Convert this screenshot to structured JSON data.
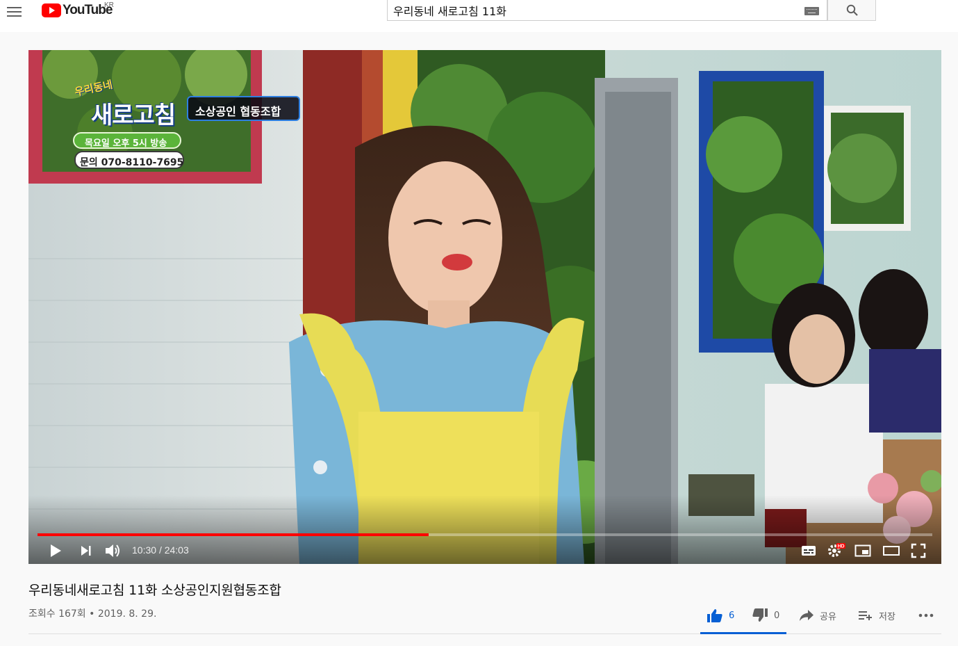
{
  "header": {
    "logo_text": "YouTube",
    "country_code": "KR",
    "search_value": "우리동네 새로고침 11화"
  },
  "player": {
    "overlay": {
      "show_title_small": "우리동네",
      "show_title_big": "새로고침",
      "episode_banner": "소상공인 협동조합",
      "air_time": "목요일 오후 5시 방송",
      "contact": "문의 070-8110-7695"
    },
    "time_current": "10:30",
    "time_total": "24:03",
    "progress_fraction": 0.437
  },
  "video": {
    "title": "우리동네새로고침 11화 소상공인지원협동조합",
    "meta": "조회수 167회 • 2019. 8. 29.",
    "likes": "6",
    "dislikes": "0",
    "share_label": "공유",
    "save_label": "저장"
  },
  "colors": {
    "youtube_red": "#ff0000",
    "accent_blue": "#065fd4",
    "overlay_green": "#5bb43a"
  }
}
